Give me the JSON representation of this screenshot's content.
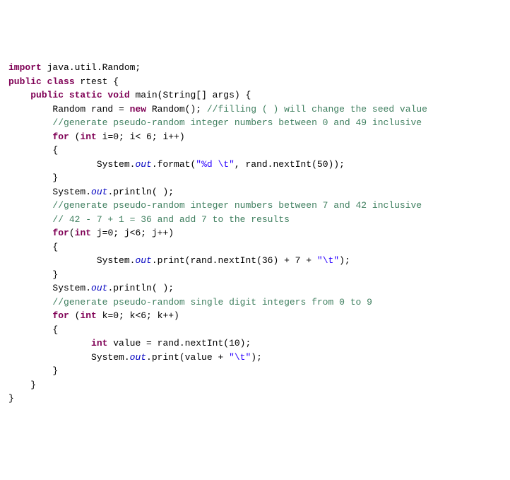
{
  "code": {
    "tokens": [
      [
        {
          "t": "import",
          "c": "kw"
        },
        {
          "t": " java.util.Random;",
          "c": ""
        }
      ],
      [
        {
          "t": "public class",
          "c": "kw"
        },
        {
          "t": " rtest {",
          "c": ""
        }
      ],
      [
        {
          "t": "",
          "c": ""
        }
      ],
      [
        {
          "t": "    ",
          "c": ""
        },
        {
          "t": "public static void",
          "c": "kw"
        },
        {
          "t": " main(String[] args) {",
          "c": ""
        }
      ],
      [
        {
          "t": "        Random rand = ",
          "c": ""
        },
        {
          "t": "new",
          "c": "kw"
        },
        {
          "t": " Random(); ",
          "c": ""
        },
        {
          "t": "//filling ( ) will change the seed value",
          "c": "cm"
        }
      ],
      [
        {
          "t": "        ",
          "c": ""
        },
        {
          "t": "//generate pseudo-random integer numbers between 0 and 49 inclusive",
          "c": "cm"
        }
      ],
      [
        {
          "t": "        ",
          "c": ""
        },
        {
          "t": "for",
          "c": "kw"
        },
        {
          "t": " (",
          "c": ""
        },
        {
          "t": "int",
          "c": "kw"
        },
        {
          "t": " i=0; i< 6; i++)",
          "c": ""
        }
      ],
      [
        {
          "t": "        {",
          "c": ""
        }
      ],
      [
        {
          "t": "                System.",
          "c": ""
        },
        {
          "t": "out",
          "c": "it"
        },
        {
          "t": ".format(",
          "c": ""
        },
        {
          "t": "\"%d \\t\"",
          "c": "str"
        },
        {
          "t": ", rand.nextInt(50));",
          "c": ""
        }
      ],
      [
        {
          "t": "        }",
          "c": ""
        }
      ],
      [
        {
          "t": "        System.",
          "c": ""
        },
        {
          "t": "out",
          "c": "it"
        },
        {
          "t": ".println( );",
          "c": ""
        }
      ],
      [
        {
          "t": "        ",
          "c": ""
        },
        {
          "t": "//generate pseudo-random integer numbers between 7 and 42 inclusive",
          "c": "cm"
        }
      ],
      [
        {
          "t": "        ",
          "c": ""
        },
        {
          "t": "// 42 - 7 + 1 = 36 and add 7 to the results",
          "c": "cm"
        }
      ],
      [
        {
          "t": "        ",
          "c": ""
        },
        {
          "t": "for",
          "c": "kw"
        },
        {
          "t": "(",
          "c": ""
        },
        {
          "t": "int",
          "c": "kw"
        },
        {
          "t": " j=0; j<6; j++)",
          "c": ""
        }
      ],
      [
        {
          "t": "        {",
          "c": ""
        }
      ],
      [
        {
          "t": "                System.",
          "c": ""
        },
        {
          "t": "out",
          "c": "it"
        },
        {
          "t": ".print(rand.nextInt(36) + 7 + ",
          "c": ""
        },
        {
          "t": "\"\\t\"",
          "c": "str"
        },
        {
          "t": ");",
          "c": ""
        }
      ],
      [
        {
          "t": "        }",
          "c": ""
        }
      ],
      [
        {
          "t": "        System.",
          "c": ""
        },
        {
          "t": "out",
          "c": "it"
        },
        {
          "t": ".println( );",
          "c": ""
        }
      ],
      [
        {
          "t": "        ",
          "c": ""
        },
        {
          "t": "//generate pseudo-random single digit integers from 0 to 9",
          "c": "cm"
        }
      ],
      [
        {
          "t": "        ",
          "c": ""
        },
        {
          "t": "for",
          "c": "kw"
        },
        {
          "t": " (",
          "c": ""
        },
        {
          "t": "int",
          "c": "kw"
        },
        {
          "t": " k=0; k<6; k++)",
          "c": ""
        }
      ],
      [
        {
          "t": "        {",
          "c": ""
        }
      ],
      [
        {
          "t": "               ",
          "c": ""
        },
        {
          "t": "int",
          "c": "kw"
        },
        {
          "t": " value = rand.nextInt(10);",
          "c": ""
        }
      ],
      [
        {
          "t": "               System.",
          "c": ""
        },
        {
          "t": "out",
          "c": "it"
        },
        {
          "t": ".print(value + ",
          "c": ""
        },
        {
          "t": "\"\\t\"",
          "c": "str"
        },
        {
          "t": ");",
          "c": ""
        }
      ],
      [
        {
          "t": "        }",
          "c": ""
        }
      ],
      [
        {
          "t": "    }",
          "c": ""
        }
      ],
      [
        {
          "t": "}",
          "c": ""
        }
      ]
    ]
  }
}
